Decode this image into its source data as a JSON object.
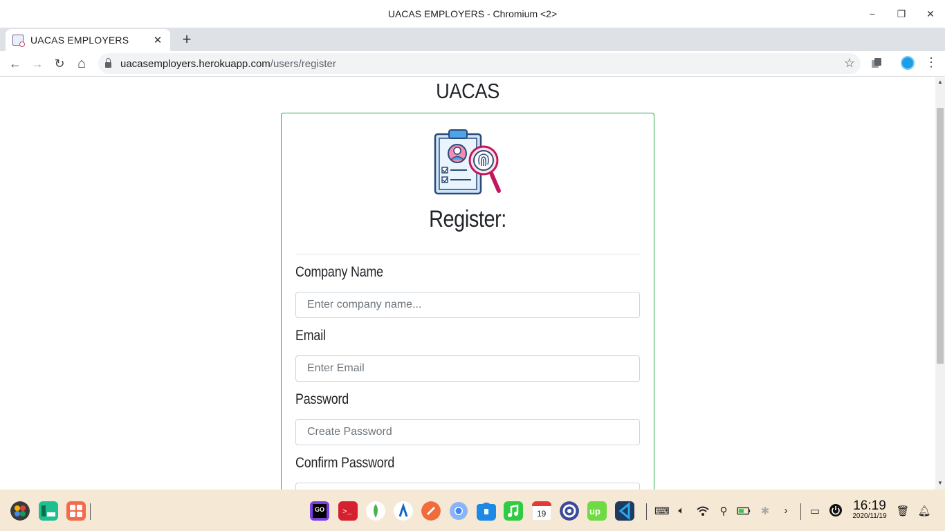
{
  "window": {
    "title": "UACAS EMPLOYERS - Chromium <2>",
    "minimize_glyph": "−",
    "restore_glyph": "❐",
    "close_glyph": "✕"
  },
  "tab": {
    "title": "UACAS EMPLOYERS",
    "close_glyph": "✕",
    "new_tab_glyph": "+"
  },
  "toolbar": {
    "back_glyph": "←",
    "forward_glyph": "→",
    "reload_glyph": "↻",
    "home_glyph": "⌂",
    "url_host": "uacasemployers.herokuapp.com",
    "url_path": "/users/register",
    "star_glyph": "☆",
    "menu_glyph": "⋮"
  },
  "page": {
    "site_title": "UACAS",
    "heading": "Register:",
    "fields": [
      {
        "label": "Company Name",
        "placeholder": "Enter company name..."
      },
      {
        "label": "Email",
        "placeholder": "Enter Email"
      },
      {
        "label": "Password",
        "placeholder": "Create Password"
      },
      {
        "label": "Confirm Password",
        "placeholder": ""
      }
    ],
    "accent_color": "#28a745"
  },
  "taskbar": {
    "time": "16:19",
    "date": "2020/11/19",
    "apps": [
      "launcher-icon",
      "files-icon",
      "app-grid-icon",
      "goland-icon",
      "terminal-icon",
      "mongodb-icon",
      "android-studio-icon",
      "postman-icon",
      "chromium-icon",
      "store-icon",
      "music-icon",
      "calendar-icon",
      "settings-icon",
      "upwork-icon",
      "vscode-icon"
    ],
    "calendar_day": "19",
    "tray": [
      "keyboard-icon",
      "volume-icon",
      "wifi-icon",
      "usb-icon",
      "battery-icon",
      "bluetooth-icon",
      "chevron-right-icon",
      "input-icon",
      "power-icon",
      "trash-icon",
      "bell-icon"
    ]
  }
}
